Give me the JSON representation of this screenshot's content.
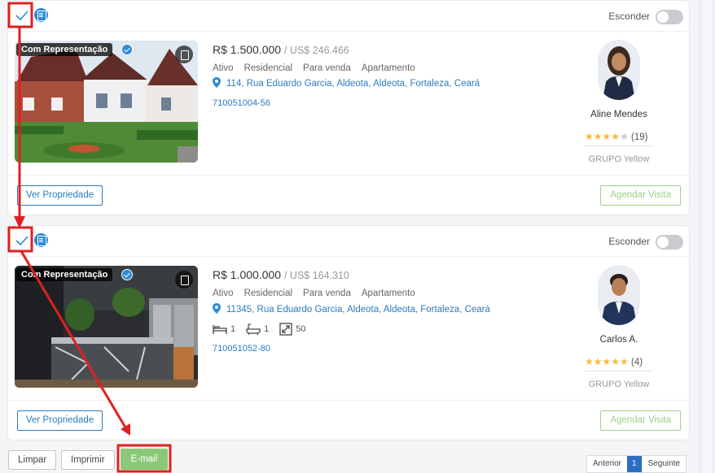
{
  "listings": [
    {
      "hide_label": "Esconder",
      "badge": "Com Representação",
      "price": "R$ 1.500.000",
      "price_usd": "/ US$ 246.466",
      "tags": [
        "Ativo",
        "Residencial",
        "Para venda",
        "Apartamento"
      ],
      "address": "114, Rua Eduardo Garcia, Aldeota, Aldeota, Fortaleza, Ceará",
      "code": "710051004-56",
      "agent": {
        "name": "Aline Mendes",
        "stars": 4,
        "reviews": "(19)",
        "group": "GRUPO Yellow"
      },
      "view_label": "Ver Propriedade",
      "schedule_label": "Agendar Visita"
    },
    {
      "hide_label": "Esconder",
      "badge": "Com Representação",
      "price": "R$ 1.000.000",
      "price_usd": "/ US$ 164.310",
      "tags": [
        "Ativo",
        "Residencial",
        "Para venda",
        "Apartamento"
      ],
      "address": "11345, Rua Eduardo Garcia, Aldeota, Aldeota, Fortaleza, Ceará",
      "features": {
        "bedrooms": "1",
        "bathrooms": "1",
        "area": "50"
      },
      "code": "710051052-80",
      "agent": {
        "name": "Carlos A.",
        "stars": 5,
        "reviews": "(4)",
        "group": "GRUPO Yellow"
      },
      "view_label": "Ver Propriedade",
      "schedule_label": "Agendar Visita"
    }
  ],
  "actions": {
    "clear": "Limpar",
    "print": "Imprimir",
    "email": "E-mail"
  },
  "pagination": {
    "prev": "Anterior",
    "current": "1",
    "next": "Seguinte"
  },
  "colors": {
    "primary": "#2b7bbf",
    "success": "#8bc979",
    "annotation": "#e02020",
    "star": "#f4b942"
  },
  "icons": [
    "check-icon",
    "document-icon",
    "map-icon",
    "location-pin-icon",
    "bed-icon",
    "bath-icon",
    "area-icon",
    "verified-icon",
    "star-icon"
  ]
}
